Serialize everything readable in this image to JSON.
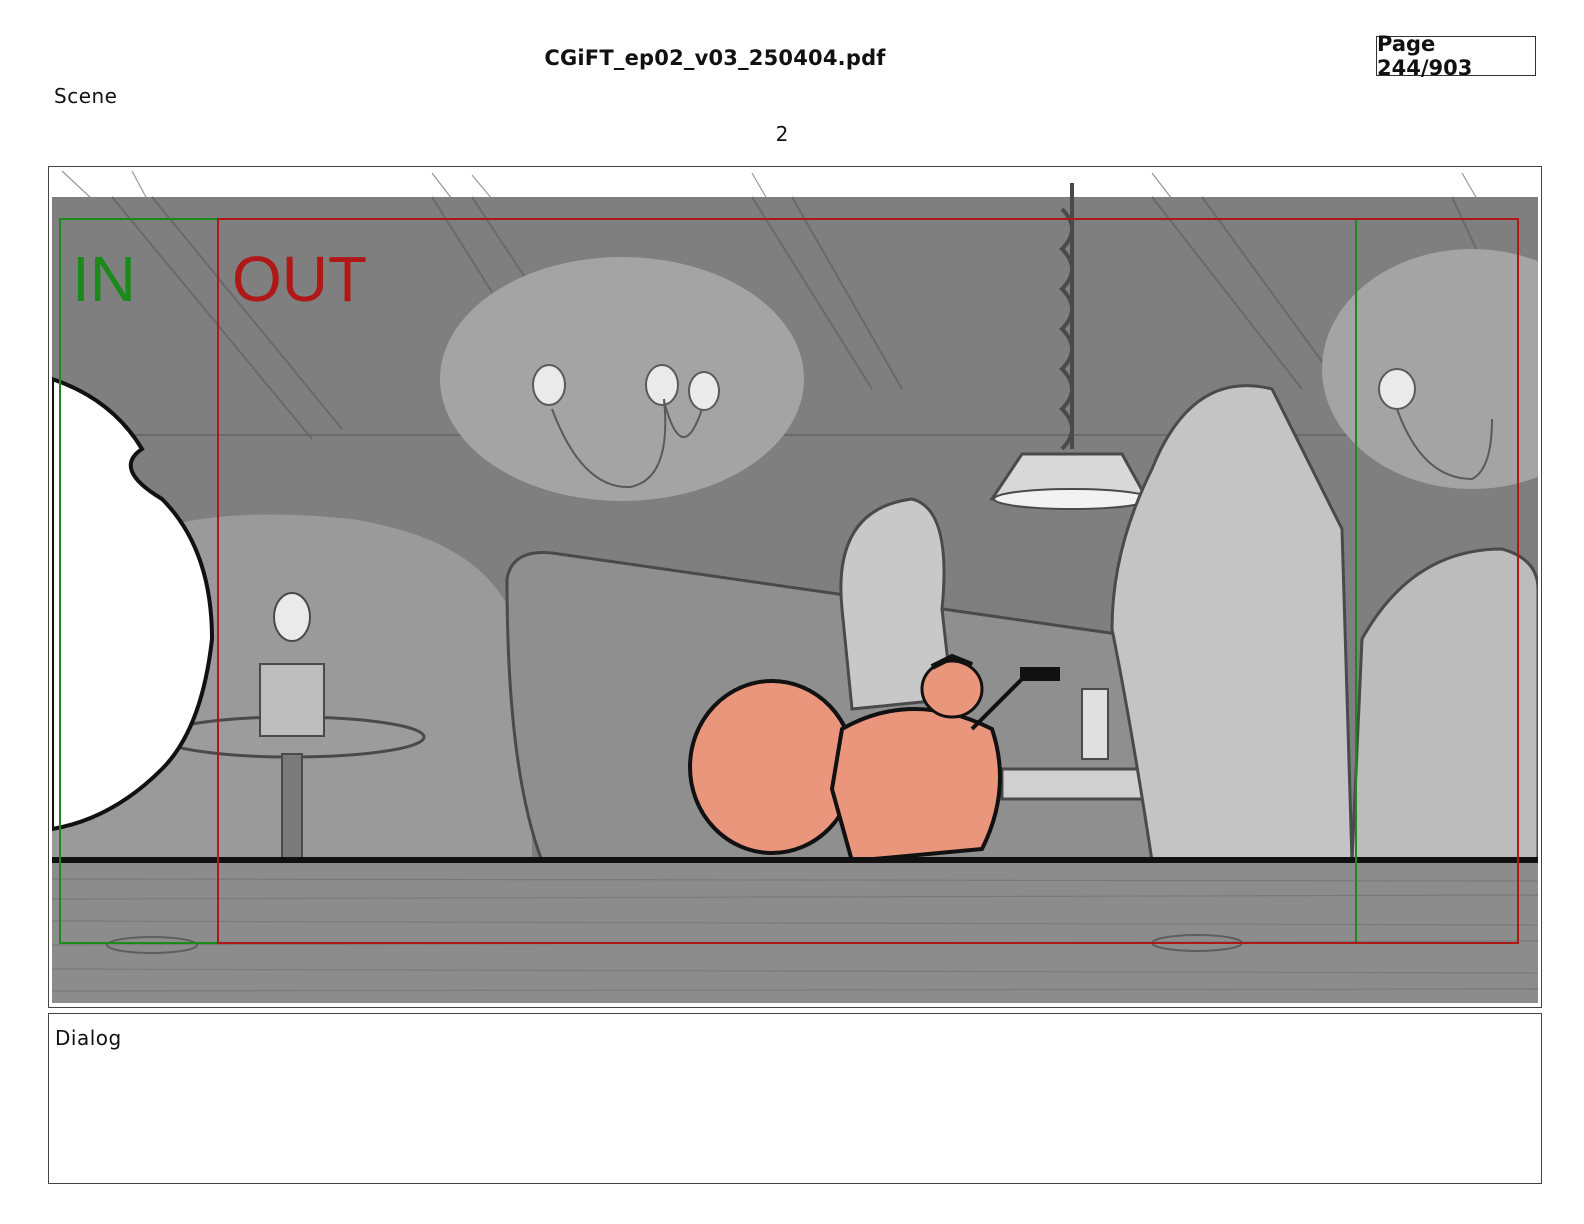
{
  "header": {
    "document_title": "CGiFT_ep02_v03_250404.pdf",
    "page_indicator": "Page 244/903"
  },
  "scene": {
    "label": "Scene",
    "number": "2"
  },
  "panel": {
    "in_marker": "IN",
    "out_marker": "OUT",
    "colors": {
      "in_guide": "#1a8a1a",
      "out_guide": "#b01818",
      "highlight_character": "#e9967d",
      "background_gray": "#808080",
      "floor_wood": "#8c8c8c"
    }
  },
  "dialog": {
    "label": "Dialog",
    "text": ""
  }
}
